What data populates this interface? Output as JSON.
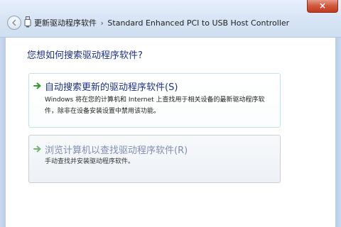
{
  "window": {
    "close_glyph": "×",
    "title_separator": "›",
    "title": "更新驱动程序软件",
    "device": "Standard Enhanced PCI to USB Host Controller"
  },
  "main": {
    "question": "您想如何搜索驱动程序软件?",
    "options": [
      {
        "title": "自动搜索更新的驱动程序软件(S)",
        "description": "Windows 将在您的计算机和 Internet 上查找用于相关设备的最新驱动程序软件，除非在设备安装设置中禁用该功能。",
        "icon": "green-arrow-icon"
      },
      {
        "title": "浏览计算机以查找驱动程序软件(R)",
        "description": "手动查找并安装驱动程序软件。",
        "icon": "green-arrow-icon"
      }
    ]
  },
  "colors": {
    "title_bar": "#dbe7f5",
    "link_blue": "#1e3287",
    "arrow_green": "#2e9b2e",
    "close_red": "#c23a1f"
  }
}
